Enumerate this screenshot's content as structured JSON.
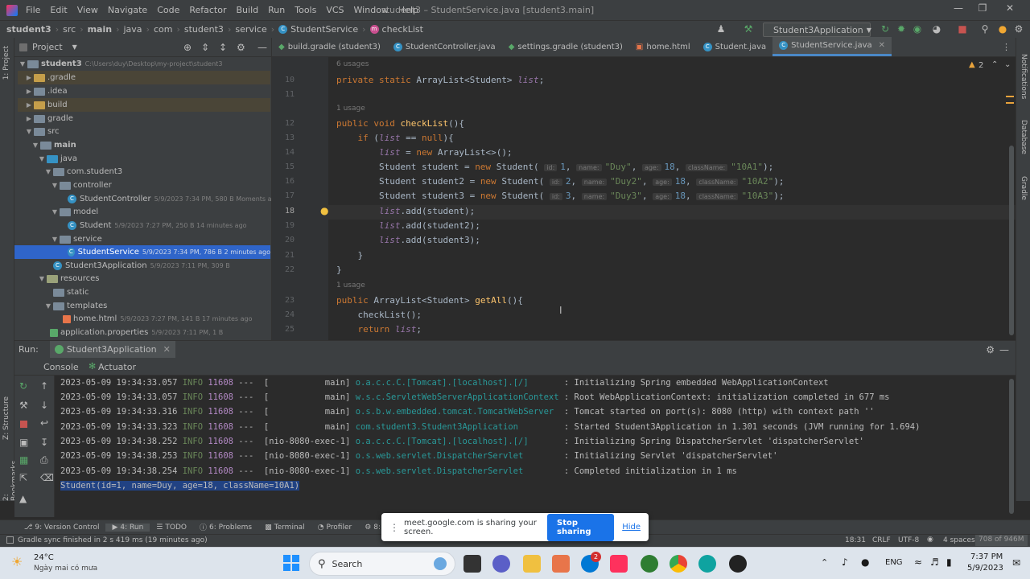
{
  "menu": {
    "items": [
      "File",
      "Edit",
      "View",
      "Navigate",
      "Code",
      "Refactor",
      "Build",
      "Run",
      "Tools",
      "VCS",
      "Window",
      "Help"
    ],
    "window_title": "student3 – StudentService.java [student3.main]"
  },
  "navbar": {
    "crumbs": [
      "student3",
      "src",
      "main",
      "java",
      "com",
      "student3",
      "service",
      "StudentService",
      "checkList"
    ],
    "run_config": "Student3Application"
  },
  "project": {
    "header": "Project",
    "items": [
      {
        "label": "student3",
        "meta": "C:\\Users\\duy\\Desktop\\my-project\\student3"
      },
      {
        "label": ".gradle",
        "meta": ""
      },
      {
        "label": ".idea",
        "meta": ""
      },
      {
        "label": "build",
        "meta": ""
      },
      {
        "label": "gradle",
        "meta": ""
      },
      {
        "label": "src",
        "meta": ""
      },
      {
        "label": "main",
        "meta": ""
      },
      {
        "label": "java",
        "meta": ""
      },
      {
        "label": "com.student3",
        "meta": ""
      },
      {
        "label": "controller",
        "meta": ""
      },
      {
        "label": "StudentController",
        "meta": "5/9/2023 7:34 PM, 580 B Moments ago"
      },
      {
        "label": "model",
        "meta": ""
      },
      {
        "label": "Student",
        "meta": "5/9/2023 7:27 PM, 250 B 14 minutes ago"
      },
      {
        "label": "service",
        "meta": ""
      },
      {
        "label": "StudentService",
        "meta": "5/9/2023 7:34 PM, 786 B 2 minutes ago"
      },
      {
        "label": "Student3Application",
        "meta": "5/9/2023 7:11 PM, 309 B"
      },
      {
        "label": "resources",
        "meta": ""
      },
      {
        "label": "static",
        "meta": ""
      },
      {
        "label": "templates",
        "meta": ""
      },
      {
        "label": "home.html",
        "meta": "5/9/2023 7:27 PM, 141 B 17 minutes ago"
      },
      {
        "label": "application.properties",
        "meta": "5/9/2023 7:11 PM, 1 B"
      }
    ]
  },
  "tabs": [
    "build.gradle (student3)",
    "StudentController.java",
    "settings.gradle (student3)",
    "home.html",
    "Student.java",
    "StudentService.java"
  ],
  "editor": {
    "usages": [
      "6 usages",
      "1 usage",
      "1 usage"
    ],
    "warnings": "2",
    "line_numbers": [
      "10",
      "11",
      "12",
      "13",
      "14",
      "15",
      "16",
      "17",
      "18",
      "19",
      "20",
      "21",
      "22",
      "23",
      "24",
      "25"
    ]
  },
  "run": {
    "label": "Run:",
    "config": "Student3Application",
    "tabs": [
      "Console",
      "Actuator"
    ],
    "logs": [
      {
        "ts": "2023-05-09 19:34:33.057",
        "lvl": "INFO",
        "pid": "11608",
        "thr": "---  [           main]",
        "logger": "o.a.c.c.C.[Tomcat].[localhost].[/]      ",
        "msg": " : Initializing Spring embedded WebApplicationContext"
      },
      {
        "ts": "2023-05-09 19:34:33.057",
        "lvl": "INFO",
        "pid": "11608",
        "thr": "---  [           main]",
        "logger": "w.s.c.ServletWebServerApplicationContext",
        "msg": " : Root WebApplicationContext: initialization completed in 677 ms"
      },
      {
        "ts": "2023-05-09 19:34:33.316",
        "lvl": "INFO",
        "pid": "11608",
        "thr": "---  [           main]",
        "logger": "o.s.b.w.embedded.tomcat.TomcatWebServer ",
        "msg": " : Tomcat started on port(s): 8080 (http) with context path ''"
      },
      {
        "ts": "2023-05-09 19:34:33.323",
        "lvl": "INFO",
        "pid": "11608",
        "thr": "---  [           main]",
        "logger": "com.student3.Student3Application        ",
        "msg": " : Started Student3Application in 1.301 seconds (JVM running for 1.694)"
      },
      {
        "ts": "2023-05-09 19:34:38.252",
        "lvl": "INFO",
        "pid": "11608",
        "thr": "---  [nio-8080-exec-1]",
        "logger": "o.a.c.c.C.[Tomcat].[localhost].[/]      ",
        "msg": " : Initializing Spring DispatcherServlet 'dispatcherServlet'"
      },
      {
        "ts": "2023-05-09 19:34:38.253",
        "lvl": "INFO",
        "pid": "11608",
        "thr": "---  [nio-8080-exec-1]",
        "logger": "o.s.web.servlet.DispatcherServlet       ",
        "msg": " : Initializing Servlet 'dispatcherServlet'"
      },
      {
        "ts": "2023-05-09 19:34:38.254",
        "lvl": "INFO",
        "pid": "11608",
        "thr": "---  [nio-8080-exec-1]",
        "logger": "o.s.web.servlet.DispatcherServlet       ",
        "msg": " : Completed initialization in 1 ms"
      }
    ],
    "output": "Student(id=1, name=Duy, age=18, className=10A1)"
  },
  "bottom_tools": [
    "9: Version Control",
    "4: Run",
    "TODO",
    "6: Problems",
    "Terminal",
    "Profiler",
    "8: Se"
  ],
  "status": {
    "message": "Gradle sync finished in 2 s 419 ms (19 minutes ago)",
    "position": "18:31",
    "line_sep": "CRLF",
    "encoding": "UTF-8",
    "indent": "4 spaces",
    "memory": "708 of 946M"
  },
  "sharing": {
    "text": "meet.google.com is sharing your screen.",
    "stop": "Stop sharing",
    "hide": "Hide"
  },
  "taskbar": {
    "weather_temp": "24°C",
    "weather_desc": "Ngày mai có mưa",
    "search": "Search",
    "lang": "ENG",
    "time": "7:37 PM",
    "date": "5/9/2023",
    "badge": "2"
  },
  "side_labels": {
    "project": "1: Project",
    "structure": "Z: Structure",
    "bookmarks": "2: Bookmarks",
    "notifications": "Notifications",
    "database": "Database",
    "gradle": "Gradle"
  }
}
